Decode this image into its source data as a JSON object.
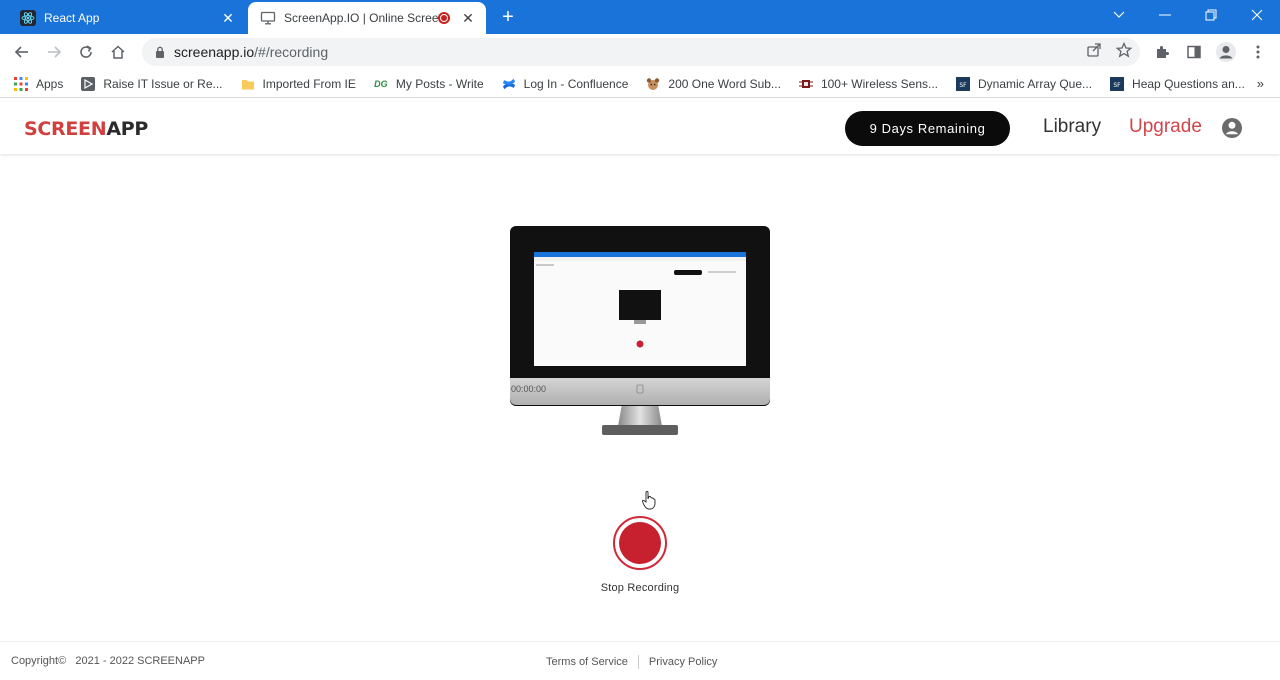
{
  "browser": {
    "tabs": [
      {
        "title": "React App",
        "favicon": "react-icon"
      },
      {
        "title": "ScreenApp.IO | Online Screen Recorder",
        "favicon": "monitor-icon",
        "recording": true
      }
    ],
    "url_host": "screenapp.io",
    "url_path": "/#/recording",
    "bookmarks": [
      {
        "label": "Apps",
        "icon": "apps-grid-icon"
      },
      {
        "label": "Raise IT Issue or Re...",
        "icon": "play-icon"
      },
      {
        "label": "Imported From IE",
        "icon": "folder-icon"
      },
      {
        "label": "My Posts - Write",
        "icon": "dg-icon"
      },
      {
        "label": "Log In - Confluence",
        "icon": "confluence-icon"
      },
      {
        "label": "200 One Word Sub...",
        "icon": "dog-icon"
      },
      {
        "label": "100+ Wireless Sens...",
        "icon": "chip-icon"
      },
      {
        "label": "Dynamic Array Que...",
        "icon": "sf-icon"
      },
      {
        "label": "Heap Questions an...",
        "icon": "sf-icon"
      }
    ],
    "bookmarks_more": "»"
  },
  "app": {
    "logo_part1": "SCREEN",
    "logo_part2": "APP",
    "days_remaining": "9 Days Remaining",
    "nav_library": "Library",
    "nav_upgrade": "Upgrade",
    "timer": "00:00:00",
    "stop_label": "Stop Recording",
    "copyright": "Copyright©   2021 - 2022 SCREENAPP",
    "terms": "Terms of Service",
    "privacy": "Privacy Policy"
  },
  "colors": {
    "tabbar": "#1a73d9",
    "brand_red": "#d0403f",
    "record_red": "#c7202f"
  }
}
